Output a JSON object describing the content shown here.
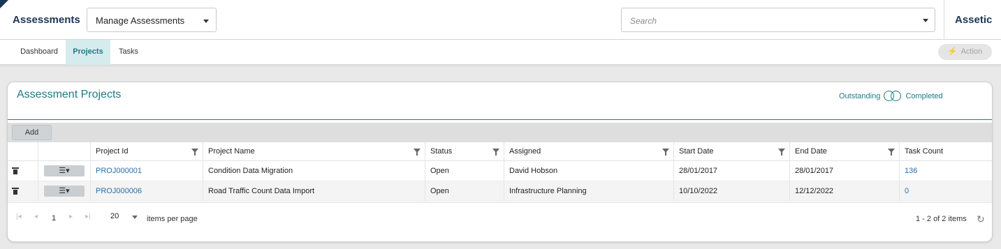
{
  "header": {
    "app_title": "Assessments",
    "module_select": "Manage Assessments",
    "search_placeholder": "Search",
    "brand": "Assetic"
  },
  "nav": {
    "tabs": [
      {
        "label": "Dashboard",
        "active": false
      },
      {
        "label": "Projects",
        "active": true
      },
      {
        "label": "Tasks",
        "active": false
      }
    ],
    "action_label": "Action"
  },
  "panel": {
    "title": "Assessment Projects",
    "toggle_left": "Outstanding",
    "toggle_right": "Completed",
    "add_label": "Add"
  },
  "grid": {
    "menu_glyph": "☰▾",
    "columns": [
      "Project Id",
      "Project Name",
      "Status",
      "Assigned",
      "Start Date",
      "End Date",
      "Task Count"
    ],
    "rows": [
      {
        "project_id": "PROJ000001",
        "project_name": "Condition Data Migration",
        "status": "Open",
        "assigned": "David Hobson",
        "start_date": "28/01/2017",
        "end_date": "28/01/2017",
        "task_count": "136"
      },
      {
        "project_id": "PROJ000006",
        "project_name": "Road Traffic Count Data Import",
        "status": "Open",
        "assigned": "Infrastructure Planning",
        "start_date": "10/10/2022",
        "end_date": "12/12/2022",
        "task_count": "0"
      }
    ]
  },
  "pager": {
    "current_page": "1",
    "page_size": "20",
    "per_page_label": "items per page",
    "item_count": "1 - 2 of 2 items"
  },
  "colors": {
    "accent": "#1f7a86",
    "brand_navy": "#1b3556",
    "link": "#2d6da3"
  }
}
